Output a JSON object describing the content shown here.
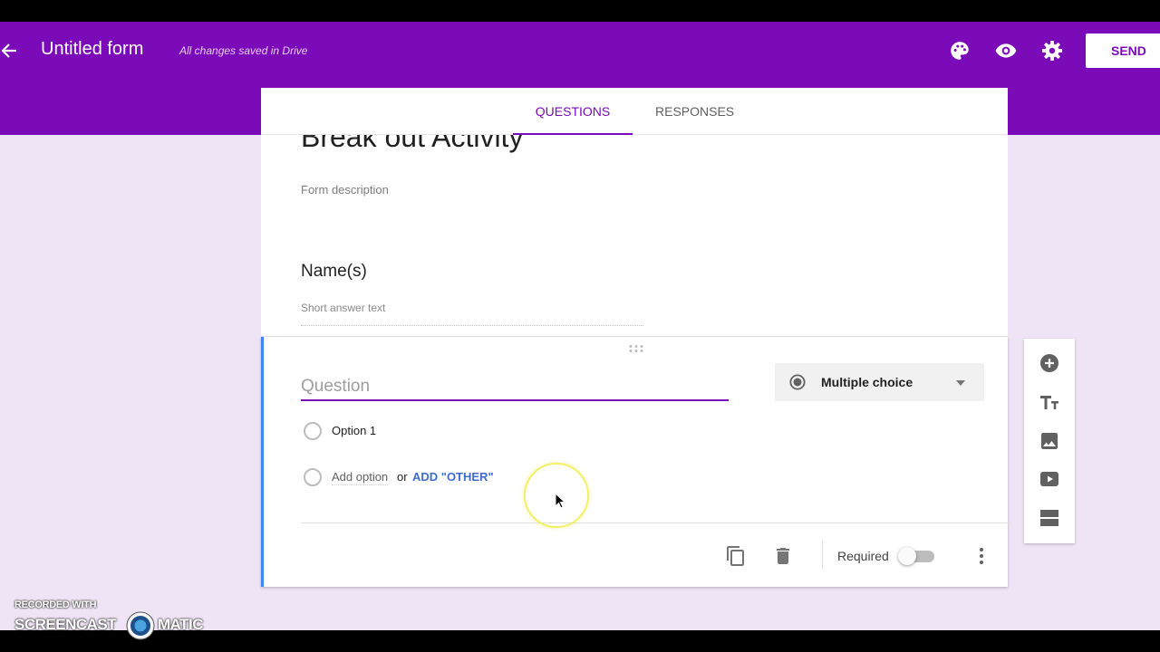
{
  "header": {
    "form_title": "Untitled form",
    "saved_status": "All changes saved in Drive",
    "send_label": "SEND",
    "icons": [
      "arrow-left-icon",
      "palette-icon",
      "eye-icon",
      "gear-icon"
    ]
  },
  "tabs": [
    {
      "label": "QUESTIONS",
      "active": true
    },
    {
      "label": "RESPONSES",
      "active": false
    }
  ],
  "form_header": {
    "heading": "Break out Activity",
    "description_placeholder": "Form description"
  },
  "questions": [
    {
      "title": "Name(s)",
      "answer_placeholder": "Short answer text"
    }
  ],
  "active_question": {
    "title_placeholder": "Question",
    "type_label": "Multiple choice",
    "options": [
      "Option 1"
    ],
    "add_option_label": "Add option",
    "or_label": "or",
    "add_other_label": "ADD \"OTHER\"",
    "required_label": "Required",
    "required_on": false
  },
  "side_toolbar": [
    "add-question-icon",
    "add-title-icon",
    "add-image-icon",
    "add-video-icon",
    "add-section-icon"
  ],
  "watermark": {
    "line1": "RECORDED WITH",
    "left": "SCREENCAST",
    "right": "MATIC"
  },
  "colors": {
    "theme": "#7b0ab8",
    "background": "#efe4f5",
    "accent_blue": "#4285f4",
    "link_blue": "#3e6bcf"
  }
}
